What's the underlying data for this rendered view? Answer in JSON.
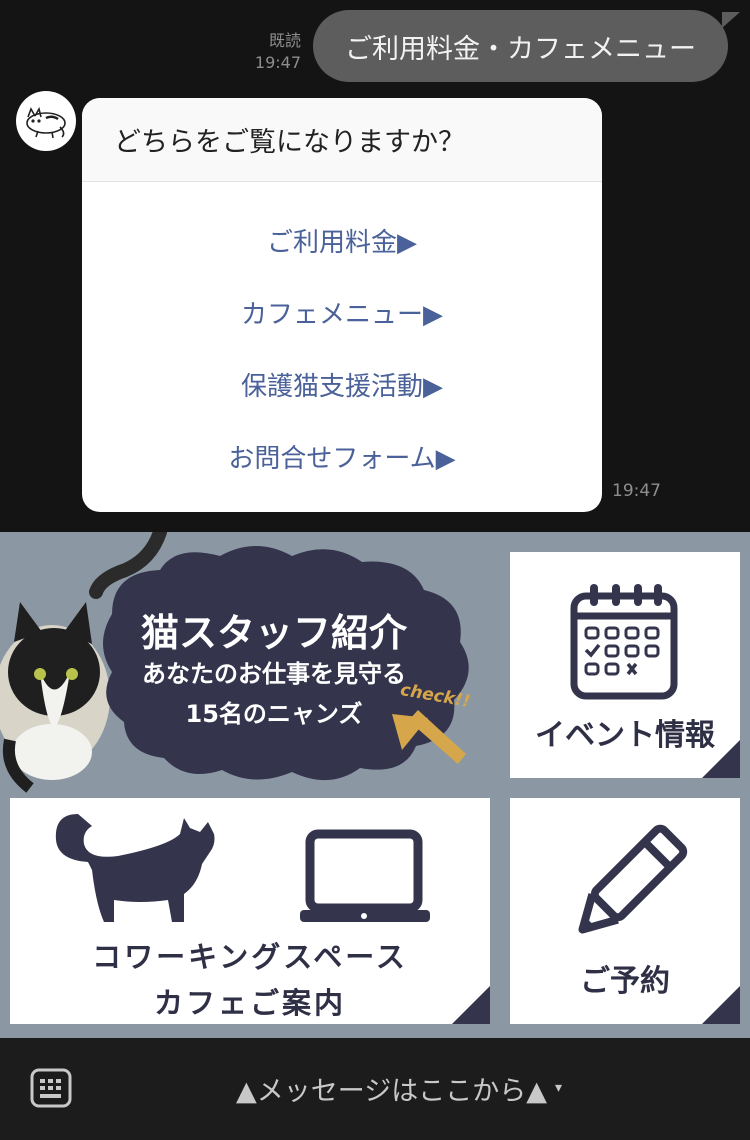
{
  "sent_message": {
    "read_label": "既読",
    "time": "19:47",
    "text": "ご利用料金・カフェメニュー"
  },
  "bot_card": {
    "question": "どちらをご覧になりますか？",
    "options": [
      "ご利用料金▶",
      "カフェメニュー▶",
      "保護猫支援活動▶",
      "お問合せフォーム▶"
    ],
    "time": "19:47"
  },
  "rich_menu": {
    "staff_banner": {
      "title": "猫スタッフ紹介",
      "subtitle": "あなたのお仕事を見守る",
      "line3": "15名のニャンズ",
      "check": "check!!"
    },
    "event": {
      "label": "イベント情報",
      "icon": "calendar-icon"
    },
    "coworking": {
      "line1": "コワーキングスペース",
      "line2": "カフェご案内",
      "icons": [
        "cat-silhouette-icon",
        "laptop-icon"
      ]
    },
    "reserve": {
      "label": "ご予約",
      "icon": "pencil-icon"
    },
    "colors": {
      "background": "#8b98a3",
      "dark": "#34344d",
      "accent": "#d6a64a"
    }
  },
  "bottom_bar": {
    "prompt": "▲メッセージはここから▲",
    "caret": "▾",
    "keyboard_icon": "keyboard-icon"
  }
}
